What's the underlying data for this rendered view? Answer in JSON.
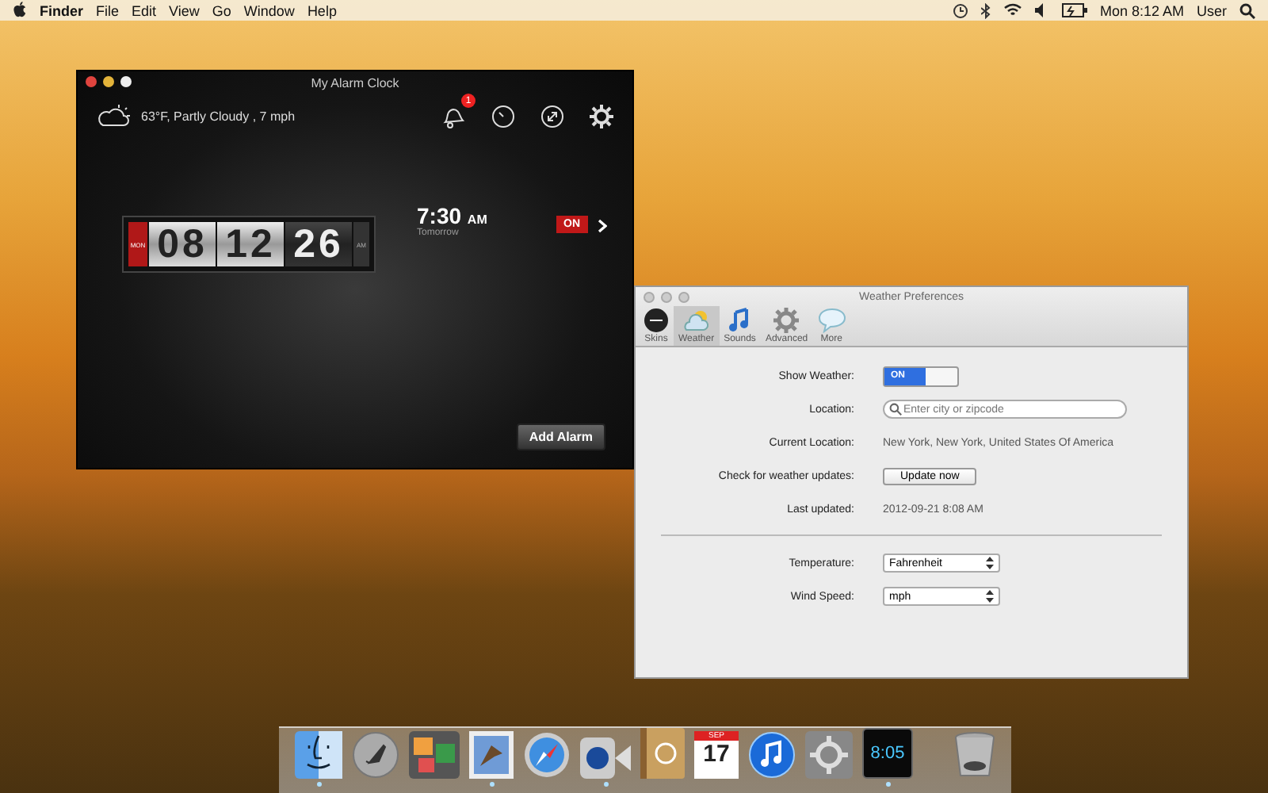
{
  "menubar": {
    "items": [
      {
        "label": "Finder",
        "bold": true
      },
      {
        "label": "File",
        "bold": false
      },
      {
        "label": "Edit",
        "bold": false
      },
      {
        "label": "View",
        "bold": false
      },
      {
        "label": "Go",
        "bold": false
      },
      {
        "label": "Window",
        "bold": false
      },
      {
        "label": "Help",
        "bold": false
      }
    ],
    "clock": "Mon 8:12 AM",
    "user": "User"
  },
  "alarm_window": {
    "title": "My Alarm Clock",
    "weather": "63°F, Partly Cloudy , 7 mph",
    "notification_badge": "1",
    "flip_clock": [
      {
        "kind": "day",
        "text": "MON"
      },
      {
        "kind": "digits",
        "text": "08"
      },
      {
        "kind": "digits",
        "text": "12"
      },
      {
        "kind": "seconds",
        "text": "26"
      },
      {
        "kind": "ampm",
        "text": "AM"
      }
    ],
    "alarm": {
      "time": "7:30",
      "meridiem": "AM",
      "day": "Tomorrow",
      "toggle": {
        "label": "ON",
        "on": true
      }
    },
    "add_button": "Add Alarm"
  },
  "prefs_window": {
    "title": "Weather Preferences",
    "tabs": [
      {
        "kind": "skins",
        "label": "Skins",
        "selected": false
      },
      {
        "kind": "weather",
        "label": "Weather",
        "selected": true
      },
      {
        "kind": "sounds",
        "label": "Sounds",
        "selected": false
      },
      {
        "kind": "advanced",
        "label": "Advanced",
        "selected": false
      },
      {
        "kind": "more",
        "label": "More",
        "selected": false
      }
    ],
    "rows": [
      {
        "kind": "toggle",
        "label": "Show Weather:",
        "value": "ON",
        "on": true
      },
      {
        "kind": "search",
        "label": "Location:",
        "placeholder": "Enter city or zipcode"
      },
      {
        "kind": "text",
        "label": "Current Location:",
        "value": "New York, New York, United States Of America"
      },
      {
        "kind": "button",
        "label": "Check for weather updates:",
        "value": "Update now"
      },
      {
        "kind": "text",
        "label": "Last updated:",
        "value": "2012-09-21 8:08 AM"
      },
      {
        "kind": "divider"
      },
      {
        "kind": "select",
        "label": "Temperature:",
        "value": "Fahrenheit"
      },
      {
        "kind": "select",
        "label": "Wind Speed:",
        "value": "mph"
      }
    ]
  },
  "dock": {
    "items": [
      {
        "kind": "finder",
        "running": true
      },
      {
        "kind": "launchpad",
        "running": false
      },
      {
        "kind": "photos",
        "running": false
      },
      {
        "kind": "mail",
        "running": true
      },
      {
        "kind": "safari",
        "running": false
      },
      {
        "kind": "facetime",
        "running": true
      },
      {
        "kind": "contacts",
        "running": false
      },
      {
        "kind": "calendar",
        "running": false,
        "month": "SEP",
        "day": "17"
      },
      {
        "kind": "music",
        "running": false
      },
      {
        "kind": "settings",
        "running": false
      },
      {
        "kind": "clock",
        "running": true,
        "time": "8:05"
      },
      {
        "kind": "trash",
        "running": false
      }
    ]
  }
}
